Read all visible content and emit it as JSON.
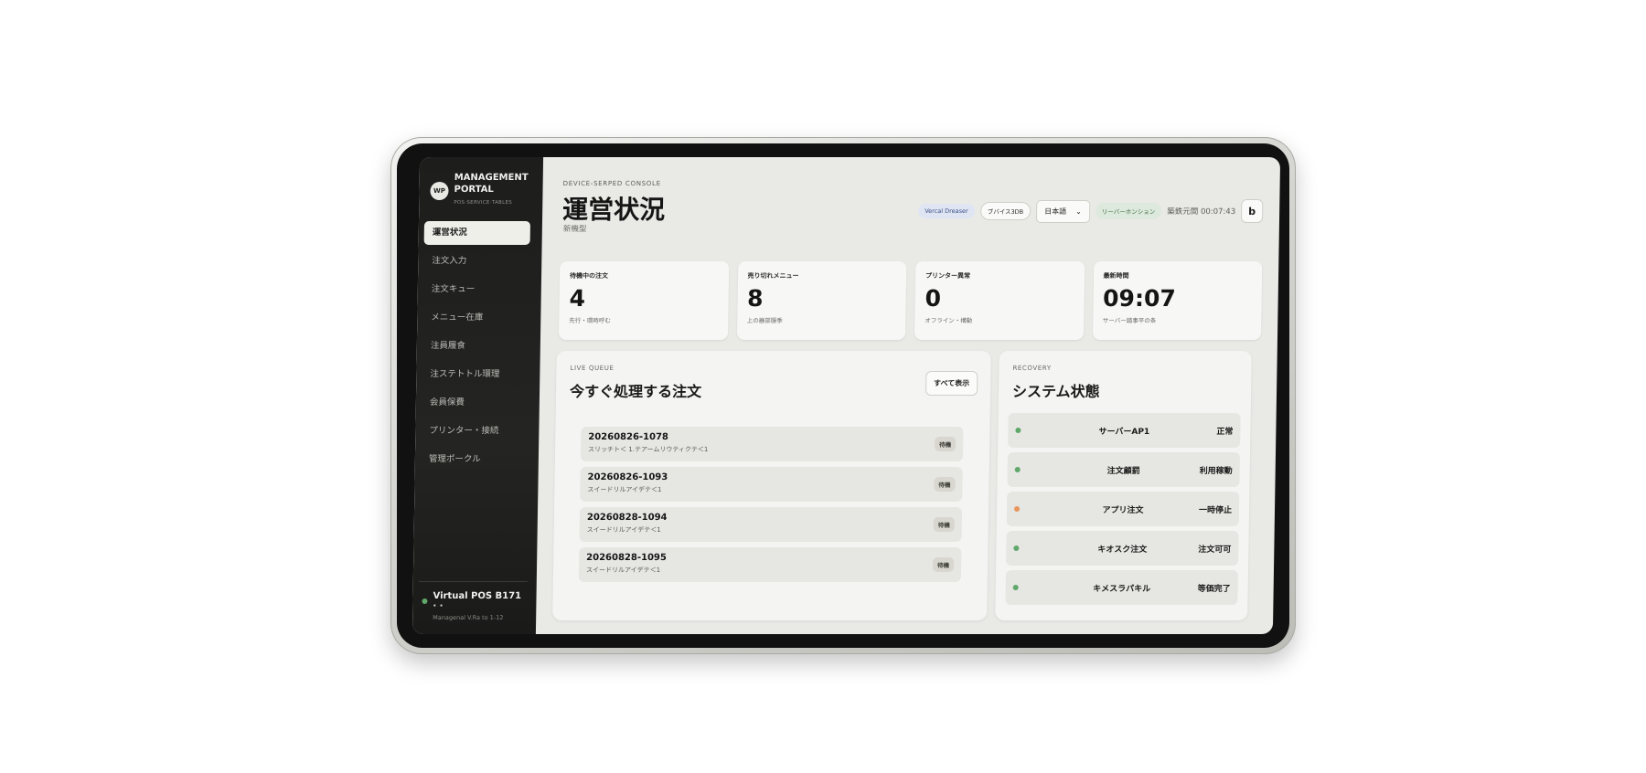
{
  "sidebar": {
    "logo": "WP",
    "brand_line1": "MANAGEMENT",
    "brand_line2": "PORTAL",
    "brand_sub": "POS·SERVICE·TABLES",
    "items": [
      {
        "label": "運営状況",
        "active": true
      },
      {
        "label": "注文入力"
      },
      {
        "label": "注文キュー"
      },
      {
        "label": "メニュー在庫"
      },
      {
        "label": "注員履食"
      },
      {
        "label": "注ステトトル環理"
      },
      {
        "label": "会員保費"
      },
      {
        "label": "プリンター・接続"
      },
      {
        "label": "管理ポークル"
      }
    ],
    "device_name": "Virtual POS B171 · ·",
    "device_sub": "Managenal V.Ra to 1-12",
    "device_status_color": "#5fa86a"
  },
  "header": {
    "eyebrow": "DEVICE-SERPED CONSOLE",
    "title": "運営状況",
    "subtitle": "新機型",
    "chip_browser": "Vercal Dreaser",
    "chip_device": "ブバイス3DB",
    "language": "日本語",
    "chip_server": "リーバーホンション",
    "updated_text": "築鉄元間 00:07:43",
    "refresh_icon": "b"
  },
  "stats": [
    {
      "label": "待機中の注文",
      "value": "4",
      "sub": "先行・環時呼む"
    },
    {
      "label": "売り切れメニュー",
      "value": "8",
      "sub": "上の器部服季"
    },
    {
      "label": "プリンター異常",
      "value": "0",
      "sub": "オフライン・構動"
    },
    {
      "label": "最新時間",
      "value": "09:07",
      "sub": "サーバー踏事平の条"
    }
  ],
  "queue": {
    "eyebrow": "LIVE QUEUE",
    "title": "今すぐ処理する注文",
    "show_all": "すべて表示",
    "orders": [
      {
        "id": "20260826-1078",
        "desc": "スリッチト＜ 1.テアームリウティクテ＜1",
        "badge": "待機"
      },
      {
        "id": "20260826-1093",
        "desc": "スイードリルアイデテ＜1",
        "badge": "待機"
      },
      {
        "id": "20260828-1094",
        "desc": "スイードリルアイデテ＜1",
        "badge": "待機"
      },
      {
        "id": "20260828-1095",
        "desc": "スイードリルアイデテ＜1",
        "badge": "待機"
      }
    ]
  },
  "recovery": {
    "eyebrow": "RECOVERY",
    "title": "システム状態",
    "items": [
      {
        "name": "サーバーAP1",
        "status": "正常",
        "color": "#5fa86a"
      },
      {
        "name": "注文顧罰",
        "status": "利用稼動",
        "color": "#5fa86a"
      },
      {
        "name": "アプリ注文",
        "status": "一時停止",
        "color": "#e8955a"
      },
      {
        "name": "キオスク注文",
        "status": "注文可可",
        "color": "#5fa86a"
      },
      {
        "name": "キメスラパキル",
        "status": "等価完了",
        "color": "#5fa86a"
      }
    ]
  }
}
